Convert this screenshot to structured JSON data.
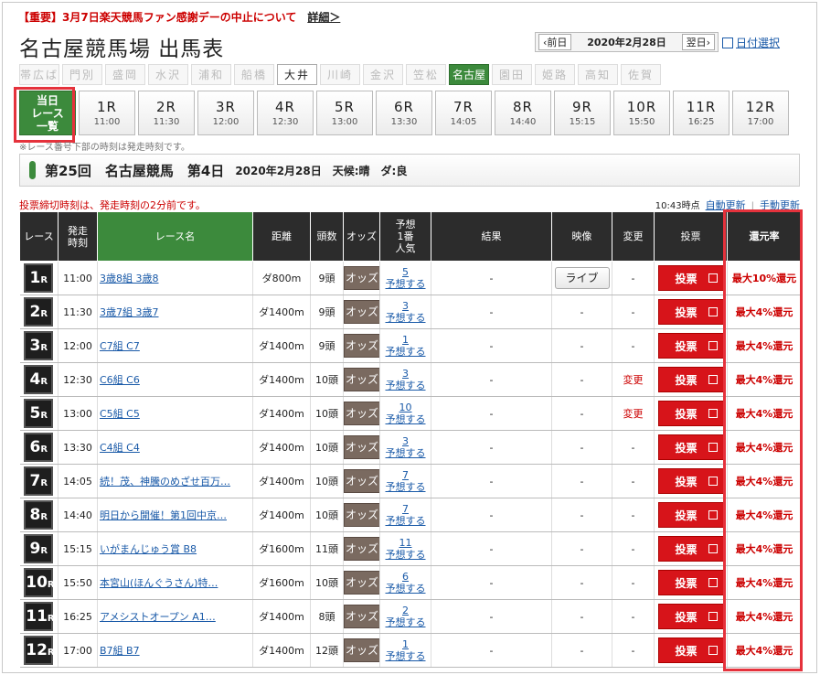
{
  "notice": {
    "text": "【重要】3月7日楽天競馬ファン感謝デーの中止について",
    "link": "詳細＞"
  },
  "title": "名古屋競馬場 出馬表",
  "date_nav": {
    "prev": "前日",
    "date": "2020年2月28日",
    "next": "翌日",
    "calendar": "日付選択"
  },
  "tracks": [
    "帯広ば",
    "門別",
    "盛岡",
    "水沢",
    "浦和",
    "船橋",
    "大井",
    "川崎",
    "金沢",
    "笠松",
    "名古屋",
    "園田",
    "姫路",
    "高知",
    "佐賀"
  ],
  "races_nav": {
    "all_label_1": "当日",
    "all_label_2": "レース",
    "all_label_3": "一覧",
    "items": [
      {
        "race": "1R",
        "time": "11:00"
      },
      {
        "race": "2R",
        "time": "11:30"
      },
      {
        "race": "3R",
        "time": "12:00"
      },
      {
        "race": "4R",
        "time": "12:30"
      },
      {
        "race": "5R",
        "time": "13:00"
      },
      {
        "race": "6R",
        "time": "13:30"
      },
      {
        "race": "7R",
        "time": "14:05"
      },
      {
        "race": "8R",
        "time": "14:40"
      },
      {
        "race": "9R",
        "time": "15:15"
      },
      {
        "race": "10R",
        "time": "15:50"
      },
      {
        "race": "11R",
        "time": "16:25"
      },
      {
        "race": "12R",
        "time": "17:00"
      }
    ]
  },
  "race_note": "※レース番号下部の時刻は発走時刻です。",
  "meeting": {
    "name": "第25回　名古屋競馬　第4日",
    "info": "2020年2月28日　天候:晴　ダ:良"
  },
  "warning": "投票締切時刻は、発走時刻の2分前です。",
  "update": {
    "time": "10:43時点",
    "auto": "自動更新",
    "manual": "手動更新"
  },
  "table": {
    "headers": {
      "race": "レース",
      "time1": "発走",
      "time2": "時刻",
      "name": "レース名",
      "dist": "距離",
      "heads": "頭数",
      "odds": "オッズ",
      "yoso1": "予想",
      "yoso2": "1番",
      "yoso3": "人気",
      "result": "結果",
      "video": "映像",
      "change": "変更",
      "vote": "投票",
      "rate": "還元率"
    },
    "odds_label": "オッズ",
    "yoso_label": "予想する",
    "vote_label": "投票",
    "rows": [
      {
        "num": "1",
        "time": "11:00",
        "name": "3歳8組  3歳8",
        "dist": "ダ800m",
        "heads": "9頭",
        "fav": "5",
        "result": "-",
        "video": "ライブ",
        "change": "-",
        "rate": "最大10%還元"
      },
      {
        "num": "2",
        "time": "11:30",
        "name": "3歳7組  3歳7",
        "dist": "ダ1400m",
        "heads": "9頭",
        "fav": "3",
        "result": "-",
        "video": "-",
        "change": "-",
        "rate": "最大4%還元"
      },
      {
        "num": "3",
        "time": "12:00",
        "name": "C7組  C7",
        "dist": "ダ1400m",
        "heads": "9頭",
        "fav": "1",
        "result": "-",
        "video": "-",
        "change": "-",
        "rate": "最大4%還元"
      },
      {
        "num": "4",
        "time": "12:30",
        "name": "C6組  C6",
        "dist": "ダ1400m",
        "heads": "10頭",
        "fav": "3",
        "result": "-",
        "video": "-",
        "change": "変更",
        "rate": "最大4%還元"
      },
      {
        "num": "5",
        "time": "13:00",
        "name": "C5組  C5",
        "dist": "ダ1400m",
        "heads": "10頭",
        "fav": "10",
        "result": "-",
        "video": "-",
        "change": "変更",
        "rate": "最大4%還元"
      },
      {
        "num": "6",
        "time": "13:30",
        "name": "C4組  C4",
        "dist": "ダ1400m",
        "heads": "10頭",
        "fav": "3",
        "result": "-",
        "video": "-",
        "change": "-",
        "rate": "最大4%還元"
      },
      {
        "num": "7",
        "time": "14:05",
        "name": "続！茂、神騰のめざせ百万…",
        "dist": "ダ1400m",
        "heads": "10頭",
        "fav": "7",
        "result": "-",
        "video": "-",
        "change": "-",
        "rate": "最大4%還元"
      },
      {
        "num": "8",
        "time": "14:40",
        "name": "明日から開催！第1回中京…",
        "dist": "ダ1400m",
        "heads": "10頭",
        "fav": "7",
        "result": "-",
        "video": "-",
        "change": "-",
        "rate": "最大4%還元"
      },
      {
        "num": "9",
        "time": "15:15",
        "name": "いがまんじゅう賞  B8",
        "dist": "ダ1600m",
        "heads": "11頭",
        "fav": "11",
        "result": "-",
        "video": "-",
        "change": "-",
        "rate": "最大4%還元"
      },
      {
        "num": "10",
        "time": "15:50",
        "name": "本宮山(ほんぐうさん)特…",
        "dist": "ダ1600m",
        "heads": "10頭",
        "fav": "6",
        "result": "-",
        "video": "-",
        "change": "-",
        "rate": "最大4%還元"
      },
      {
        "num": "11",
        "time": "16:25",
        "name": "アメシストオープン  A1…",
        "dist": "ダ1400m",
        "heads": "8頭",
        "fav": "2",
        "result": "-",
        "video": "-",
        "change": "-",
        "rate": "最大4%還元"
      },
      {
        "num": "12",
        "time": "17:00",
        "name": "B7組  B7",
        "dist": "ダ1400m",
        "heads": "12頭",
        "fav": "1",
        "result": "-",
        "video": "-",
        "change": "-",
        "rate": "最大4%還元"
      }
    ]
  },
  "colors": {
    "accent_green": "#3c8a3c",
    "vote_red": "#d7141a",
    "highlight_red": "#e5323c",
    "link_blue": "#1a5aa8"
  }
}
